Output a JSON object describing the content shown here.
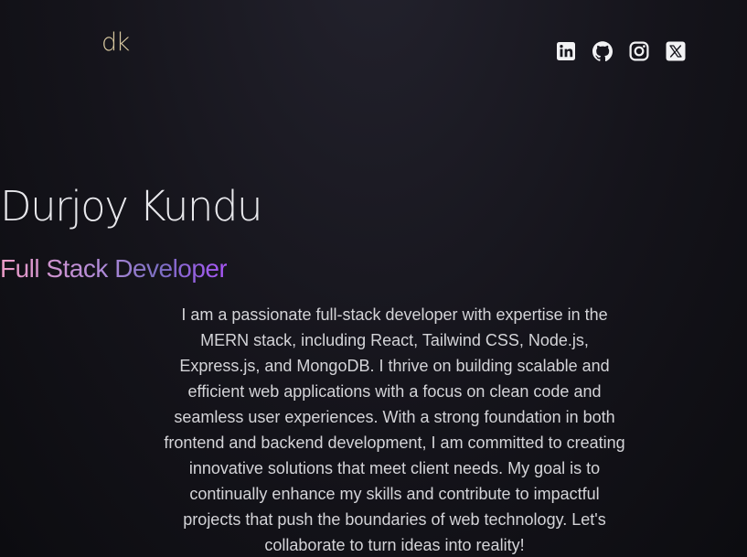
{
  "header": {
    "logo_text": "dk",
    "socials": [
      {
        "label": "LinkedIn",
        "icon": "linkedin-icon"
      },
      {
        "label": "GitHub",
        "icon": "github-icon"
      },
      {
        "label": "Instagram",
        "icon": "instagram-icon"
      },
      {
        "label": "X",
        "icon": "x-icon"
      }
    ]
  },
  "hero": {
    "name": "Durjoy Kundu",
    "role": "Full Stack Developer",
    "bio": "I am a passionate full-stack developer with expertise in the MERN stack, including React, Tailwind CSS, Node.js, Express.js, and MongoDB. I thrive on building scalable and efficient web applications with a focus on clean code and seamless user experiences. With a strong foundation in both frontend and backend development, I am committed to creating innovative solutions that meet client needs. My goal is to continually enhance my skills and contribute to impactful projects that push the boundaries of web technology. Let's collaborate to turn ideas into reality!"
  },
  "colors": {
    "background": "#15141b",
    "logo": "#d8c8a0",
    "name": "#e8e8ec",
    "role_gradient": [
      "#ec9bc6",
      "#b08ad8",
      "#7c6fc2",
      "#a855f7"
    ],
    "body_text": "#d4d4d8",
    "icons": "#f2f2f4"
  }
}
